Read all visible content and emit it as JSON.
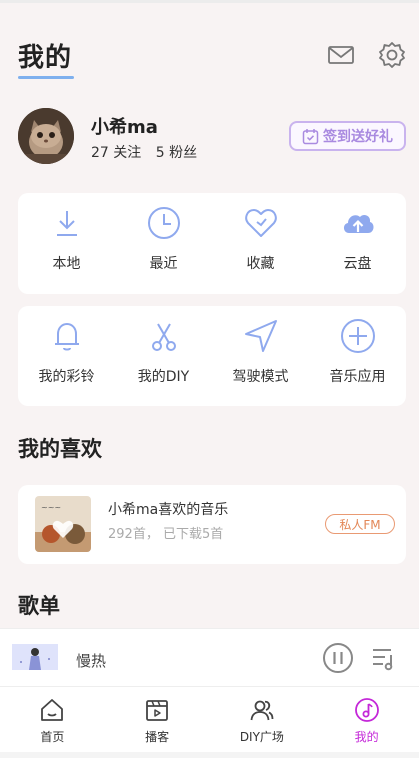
{
  "header": {
    "title": "我的",
    "mail_icon": "mail-icon",
    "settings_icon": "gear-icon"
  },
  "profile": {
    "username": "小希ma",
    "following": "27 关注",
    "followers": "5 粉丝",
    "checkin_label": "签到送好礼"
  },
  "quick_grid": [
    {
      "label": "本地",
      "icon": "download-icon"
    },
    {
      "label": "最近",
      "icon": "clock-icon"
    },
    {
      "label": "收藏",
      "icon": "heart-icon"
    },
    {
      "label": "云盘",
      "icon": "cloud-upload-icon"
    }
  ],
  "feature_grid": [
    {
      "label": "我的彩铃",
      "icon": "bell-icon"
    },
    {
      "label": "我的DIY",
      "icon": "scissors-icon"
    },
    {
      "label": "驾驶模式",
      "icon": "navigation-icon"
    },
    {
      "label": "音乐应用",
      "icon": "plus-circle-icon"
    }
  ],
  "favorites": {
    "section_title": "我的喜欢",
    "playlist_title": "小希ma喜欢的音乐",
    "stats": "292首， 已下载5首",
    "fm_label": "私人FM"
  },
  "playlists": {
    "section_title": "歌单"
  },
  "player": {
    "title": "慢热",
    "play_state": "playing"
  },
  "tabbar": [
    {
      "label": "首页",
      "icon": "home-icon",
      "active": false
    },
    {
      "label": "播客",
      "icon": "video-icon",
      "active": false
    },
    {
      "label": "DIY广场",
      "icon": "users-icon",
      "active": false
    },
    {
      "label": "我的",
      "icon": "music-note-icon",
      "active": true
    }
  ],
  "colors": {
    "accent_blue": "#8fa9ee",
    "accent_purple": "#a98ae0",
    "accent_orange": "#e38757",
    "active_tab": "#c427d8"
  }
}
